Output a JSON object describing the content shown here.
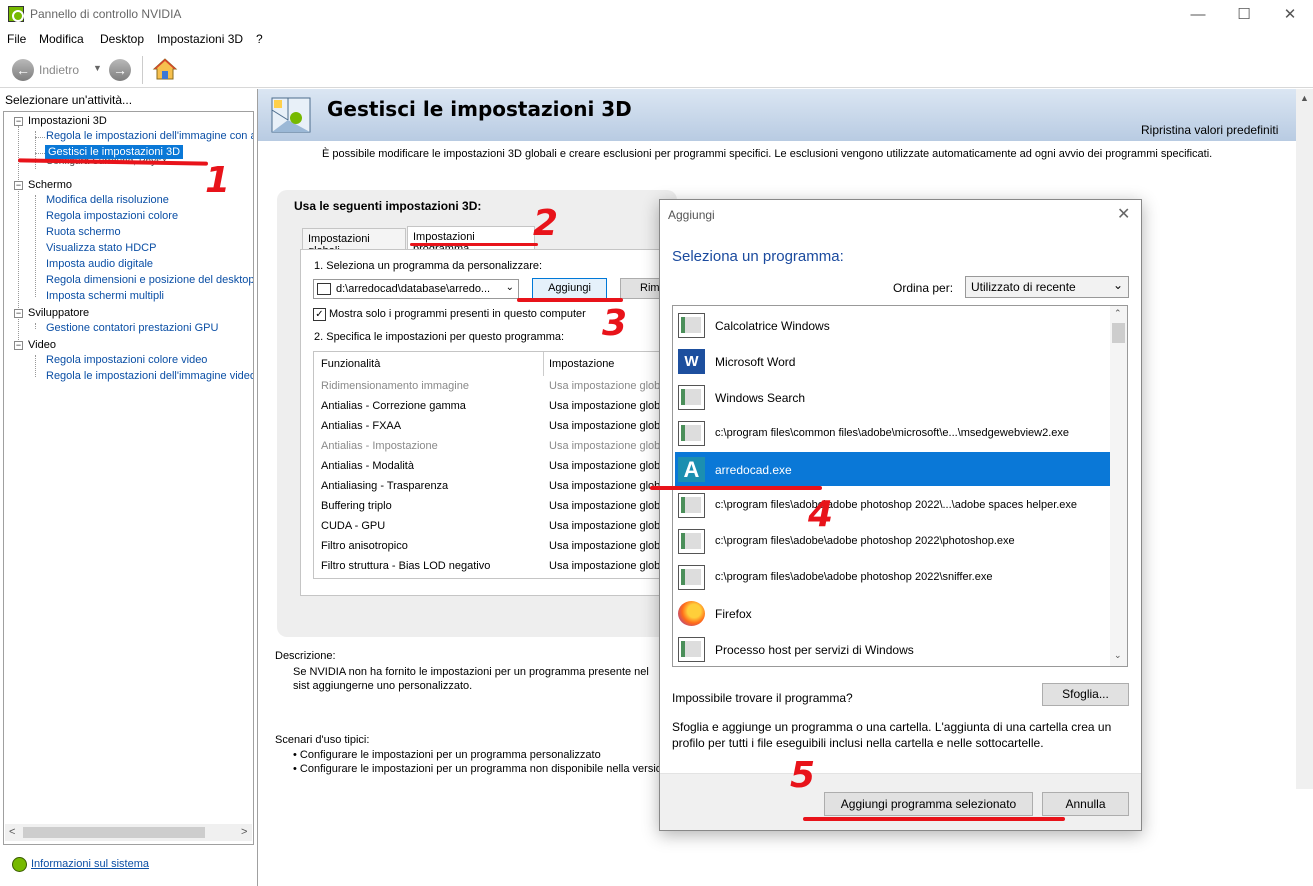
{
  "window": {
    "title": "Pannello di controllo NVIDIA",
    "minimize": "—",
    "maximize": "☐",
    "close": "✕"
  },
  "menu": [
    "File",
    "Modifica",
    "Desktop",
    "Impostazioni 3D",
    "?"
  ],
  "toolbar": {
    "back_label": "Indietro"
  },
  "left": {
    "title": "Selezionare un'attività...",
    "tree": [
      {
        "label": "Impostazioni 3D",
        "children": [
          "Regola le impostazioni dell'immagine con an",
          "Gestisci le impostazioni 3D",
          "Configura Surround, PhysX"
        ]
      },
      {
        "label": "Schermo",
        "children": [
          "Modifica della risoluzione",
          "Regola impostazioni colore",
          "Ruota schermo",
          "Visualizza stato HDCP",
          "Imposta audio digitale",
          "Regola dimensioni e posizione del desktop",
          "Imposta schermi multipli"
        ]
      },
      {
        "label": "Sviluppatore",
        "children": [
          "Gestione contatori prestazioni GPU"
        ]
      },
      {
        "label": "Video",
        "children": [
          "Regola impostazioni colore video",
          "Regola le impostazioni dell'immagine video"
        ]
      }
    ],
    "system_info": "Informazioni sul sistema"
  },
  "main": {
    "title": "Gestisci le impostazioni 3D",
    "restore": "Ripristina valori predefiniti",
    "intro": "È possibile modificare le impostazioni 3D globali e creare esclusioni per programmi specifici. Le esclusioni vengono utilizzate automaticamente ad ogni avvio dei programmi specificati.",
    "box_title": "Usa le seguenti impostazioni 3D:",
    "tabs": [
      "Impostazioni globali",
      "Impostazioni programma"
    ],
    "step1": "1. Seleziona un programma da personalizzare:",
    "program_value": "d:\\arredocad\\database\\arredo...",
    "add_button": "Aggiungi",
    "remove_button": "Rimu",
    "only_installed": "Mostra solo i programmi presenti in questo computer",
    "step2": "2. Specifica le impostazioni per questo programma:",
    "table_headers": [
      "Funzionalità",
      "Impostazione"
    ],
    "features": [
      {
        "name": "Ridimensionamento immagine",
        "value": "Usa impostazione globa",
        "disabled": true
      },
      {
        "name": "Antialias - Correzione gamma",
        "value": "Usa impostazione globa",
        "disabled": false
      },
      {
        "name": "Antialias - FXAA",
        "value": "Usa impostazione globa",
        "disabled": false
      },
      {
        "name": "Antialias - Impostazione",
        "value": "Usa impostazione globa",
        "disabled": true
      },
      {
        "name": "Antialias - Modalità",
        "value": "Usa impostazione globa",
        "disabled": false
      },
      {
        "name": "Antialiasing - Trasparenza",
        "value": "Usa impostazione glob",
        "disabled": false
      },
      {
        "name": "Buffering triplo",
        "value": "Usa impostazione globa",
        "disabled": false
      },
      {
        "name": "CUDA - GPU",
        "value": "Usa impostazione globa",
        "disabled": false
      },
      {
        "name": "Filtro anisotropico",
        "value": "Usa impostazione globa",
        "disabled": false
      },
      {
        "name": "Filtro struttura - Bias LOD negativo",
        "value": "Usa impostazione globa",
        "disabled": false
      }
    ],
    "description_title": "Descrizione:",
    "description": "Se NVIDIA non ha fornito le impostazioni per un programma presente nel sist aggiungerne uno personalizzato.",
    "usage_title": "Scenari d'uso tipici:",
    "usage": [
      "• Configurare le impostazioni per un programma personalizzato",
      "• Configurare le impostazioni per un programma non disponibile nella versione"
    ]
  },
  "dialog": {
    "title": "Aggiungi",
    "heading": "Seleziona un programma:",
    "sort_label": "Ordina per:",
    "sort_value": "Utilizzato di recente",
    "programs": [
      {
        "label": "Calcolatrice Windows",
        "icon": "app-icon"
      },
      {
        "label": "Microsoft Word",
        "icon": "word-icon"
      },
      {
        "label": "Windows Search",
        "icon": "app-icon"
      },
      {
        "label": "c:\\program files\\common files\\adobe\\microsoft\\e...\\msedgewebview2.exe",
        "icon": "app-icon"
      },
      {
        "label": "arredocad.exe",
        "icon": "arredocad-icon",
        "selected": true
      },
      {
        "label": "c:\\program files\\adobe\\adobe photoshop 2022\\...\\adobe spaces helper.exe",
        "icon": "app-icon"
      },
      {
        "label": "c:\\program files\\adobe\\adobe photoshop 2022\\photoshop.exe",
        "icon": "app-icon"
      },
      {
        "label": "c:\\program files\\adobe\\adobe photoshop 2022\\sniffer.exe",
        "icon": "app-icon"
      },
      {
        "label": "Firefox",
        "icon": "firefox-icon"
      },
      {
        "label": "Processo host per servizi di Windows",
        "icon": "app-icon"
      }
    ],
    "not_found": "Impossibile trovare il programma?",
    "browse_button": "Sfoglia...",
    "browse_help": "Sfoglia e aggiunge un programma o una cartella. L'aggiunta di una cartella crea un profilo per tutti i file eseguibili inclusi nella cartella e nelle sottocartelle.",
    "add_selected_button": "Aggiungi programma selezionato",
    "cancel_button": "Annulla"
  },
  "annotations": [
    "1",
    "2",
    "3",
    "4",
    "5"
  ],
  "colors": {
    "accent": "#0a78d7",
    "annotation": "#e8131a",
    "nvidia": "#76b900",
    "link": "#0b4fa5"
  }
}
